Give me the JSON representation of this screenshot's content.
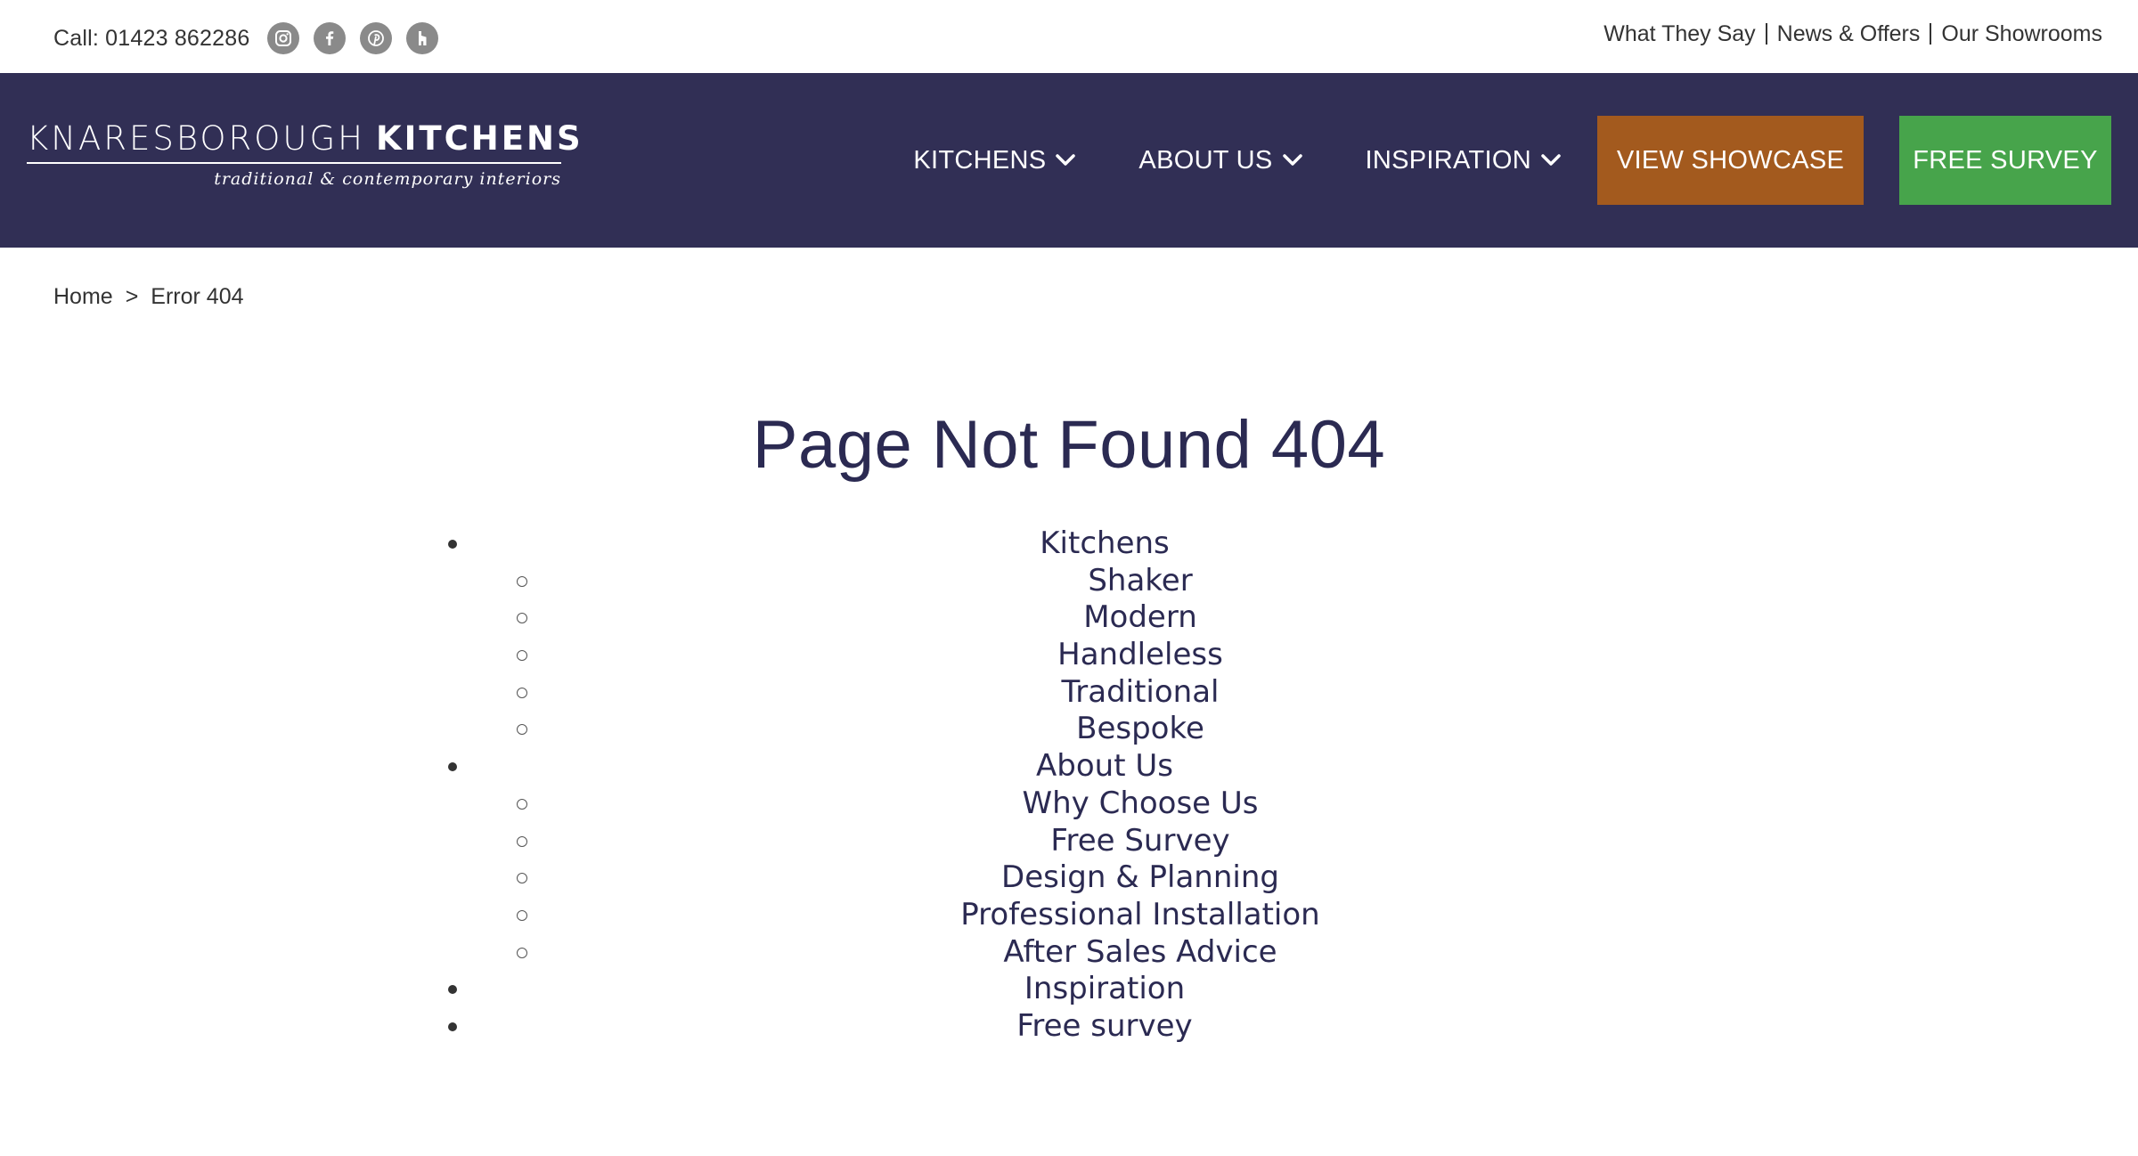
{
  "topbar": {
    "call_text": "Call: 01423 862286",
    "social_icons": [
      "instagram-icon",
      "facebook-icon",
      "pinterest-icon",
      "houzz-icon"
    ],
    "links": [
      "What They Say",
      "News & Offers",
      "Our Showrooms"
    ]
  },
  "header": {
    "logo": {
      "name_light": "KNARESBOROUGH",
      "name_bold": "KITCHENS",
      "tagline": "traditional & contemporary interiors"
    },
    "nav": [
      {
        "label": "KITCHENS",
        "icon": "chevron-down-icon"
      },
      {
        "label": "ABOUT US",
        "icon": "chevron-down-icon"
      },
      {
        "label": "INSPIRATION",
        "icon": "chevron-down-icon"
      }
    ],
    "showcase_button": "VIEW SHOWCASE",
    "survey_button": "FREE SURVEY"
  },
  "breadcrumb": {
    "home": "Home",
    "separator": ">",
    "current": "Error 404"
  },
  "page_title": "Page Not Found 404",
  "sitemap": [
    {
      "label": "Kitchens",
      "children": [
        "Shaker",
        "Modern",
        "Handleless",
        "Traditional",
        "Bespoke"
      ]
    },
    {
      "label": "About Us",
      "children": [
        "Why Choose Us",
        "Free Survey",
        "Design & Planning",
        "Professional Installation",
        "After Sales Advice"
      ]
    },
    {
      "label": "Inspiration",
      "children": []
    },
    {
      "label": "Free survey",
      "children": []
    }
  ],
  "colors": {
    "header_bg": "#312f55",
    "showcase_button": "#a35a1e",
    "survey_button": "#47a44b",
    "title_text": "#2b2a52",
    "social_icon_bg": "#8a8a8a"
  }
}
